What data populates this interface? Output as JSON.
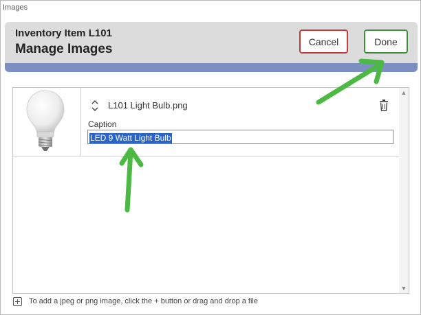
{
  "window": {
    "title": "Images"
  },
  "header": {
    "subtitle": "Inventory Item L101",
    "title": "Manage Images",
    "cancel_label": "Cancel",
    "done_label": "Done"
  },
  "images": [
    {
      "file_name": "L101 Light Bulb.png",
      "caption_label": "Caption",
      "caption_value": "LED 9 Watt Light Bulb"
    }
  ],
  "footer": {
    "hint": "To add a jpeg or png image, click the + button or drag and drop a file"
  },
  "icons": {
    "sort": "sort-updown-icon",
    "delete": "trash-icon",
    "add": "add-plus-icon"
  },
  "colors": {
    "header_bg": "#dcdcdc",
    "header_band": "#7b8fc3",
    "cancel_border": "#c03a3a",
    "done_border": "#3f8f3a",
    "selection": "#2a64c8",
    "annotation_arrow": "#4cb944"
  }
}
